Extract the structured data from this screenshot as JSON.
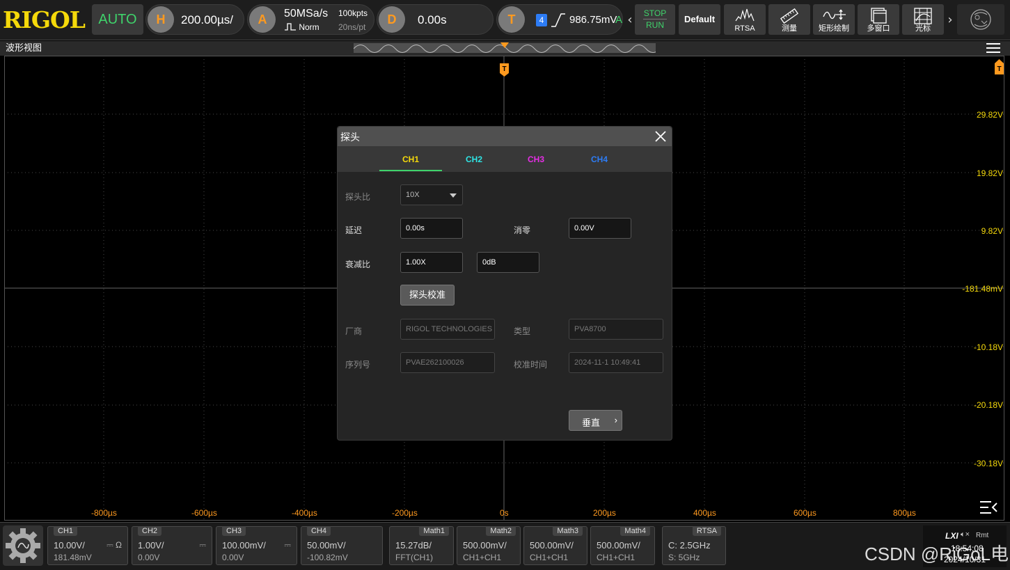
{
  "topbar": {
    "logo": "RIGOL",
    "auto": "AUTO",
    "horizontal": {
      "icon": "H",
      "value": "200.00µs/"
    },
    "acquire": {
      "icon": "A",
      "rate": "50MSa/s",
      "mode": "Norm",
      "depth": "100kpts",
      "interval": "20ns/pt"
    },
    "delay": {
      "icon": "D",
      "value": "0.00s"
    },
    "trigger": {
      "icon": "T",
      "channel": "4",
      "level": "986.75mV",
      "mode": "A"
    },
    "stop": "STOP",
    "run": "RUN",
    "default": "Default",
    "tools": [
      {
        "label": "RTSA",
        "icon": "rtsa-icon"
      },
      {
        "label": "测量",
        "icon": "ruler-icon"
      },
      {
        "label": "矩形绘制",
        "icon": "draw-icon"
      },
      {
        "label": "多窗口",
        "icon": "multi-window-icon"
      },
      {
        "label": "光标",
        "icon": "cursor-icon"
      }
    ]
  },
  "waveform": {
    "title": "波形视图",
    "trigger_marker": "T",
    "y_labels": [
      "29.82V",
      "19.82V",
      "9.82V",
      "-181.48mV",
      "-10.18V",
      "-20.18V",
      "-30.18V"
    ],
    "x_labels": [
      "-800µs",
      "-600µs",
      "-400µs",
      "-200µs",
      "0s",
      "200µs",
      "400µs",
      "600µs",
      "800µs"
    ]
  },
  "dialog": {
    "title": "探头",
    "tabs": [
      {
        "label": "CH1",
        "color": "#f5d90a"
      },
      {
        "label": "CH2",
        "color": "#2ee6e6"
      },
      {
        "label": "CH3",
        "color": "#e62ee6"
      },
      {
        "label": "CH4",
        "color": "#2d7cf5"
      }
    ],
    "probe_ratio_label": "探头比",
    "probe_ratio_value": "10X",
    "delay_label": "延迟",
    "delay_value": "0.00s",
    "zero_label": "消零",
    "zero_value": "0.00V",
    "atten_label": "衰减比",
    "atten_value": "1.00X",
    "atten_db": "0dB",
    "calibrate": "探头校准",
    "vendor_label": "厂商",
    "vendor_value": "RIGOL TECHNOLOGIES",
    "type_label": "类型",
    "type_value": "PVA8700",
    "serial_label": "序列号",
    "serial_value": "PVAE262100026",
    "caltime_label": "校准时间",
    "caltime_value": "2024-11-1 10:49:41",
    "vertical": "垂直"
  },
  "bottombar": {
    "channels": [
      {
        "name": "CH1",
        "scale": "10.00V/",
        "offset": "181.48mV",
        "coupling": "⎓ Ω"
      },
      {
        "name": "CH2",
        "scale": "1.00V/",
        "offset": "0.00V",
        "coupling": "⎓"
      },
      {
        "name": "CH3",
        "scale": "100.00mV/",
        "offset": "0.00V",
        "coupling": "⎓"
      },
      {
        "name": "CH4",
        "scale": "50.00mV/",
        "offset": "-100.82mV",
        "coupling": ""
      }
    ],
    "maths": [
      {
        "name": "Math1",
        "scale": "15.27dB/",
        "source": "FFT(CH1)"
      },
      {
        "name": "Math2",
        "scale": "500.00mV/",
        "source": "CH1+CH1"
      },
      {
        "name": "Math3",
        "scale": "500.00mV/",
        "source": "CH1+CH1"
      },
      {
        "name": "Math4",
        "scale": "500.00mV/",
        "source": "CH1+CH1"
      }
    ],
    "rtsa": {
      "name": "RTSA",
      "center": "C: 2.5GHz",
      "span": "S: 5GHz"
    },
    "status": {
      "lxi": "LXI",
      "rmt": "Rmt",
      "time": "18:54:08",
      "date": "2024/10/31"
    }
  },
  "watermark": "CSDN @RiGoL电"
}
